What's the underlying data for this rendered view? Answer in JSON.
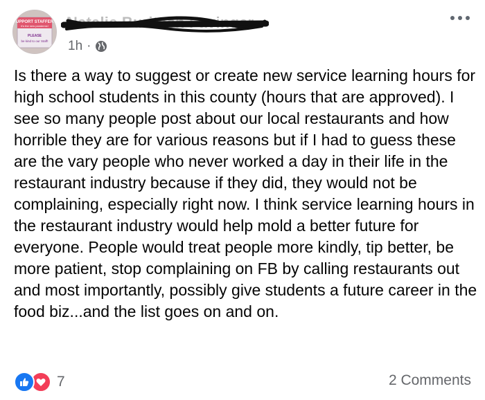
{
  "post": {
    "author": "Natalie Buritsch Favinger",
    "timestamp": "1h",
    "separator": "·",
    "avatar_sign": {
      "line1": "SUPPORT STAFFERS",
      "line2": "it's the new pandemic!",
      "line3": "PLEASE",
      "line4": "be kind to our Staff!"
    },
    "text": "Is there a way to suggest or create new service learning hours for high school students in this county (hours that are approved). I see so many people post about our local restaurants and how horrible they are for various reasons but if I had to guess these are the vary people who never worked a day in their life in the restaurant industry because if they did, they would not be complaining, especially right now. I think service learning hours in the restaurant industry would help mold a better future for everyone. People would treat people more kindly, tip better, be more patient, stop complaining on FB by calling restaurants out and most importantly, possibly give students a future career in the food biz...and the list goes on and on.",
    "reactions": {
      "count": "7",
      "icons": [
        "like-icon",
        "love-icon"
      ]
    },
    "comments_label": "2 Comments"
  },
  "colors": {
    "like_blue": "#1877f2",
    "love_red": "#f33e58",
    "meta_gray": "#65676b"
  }
}
